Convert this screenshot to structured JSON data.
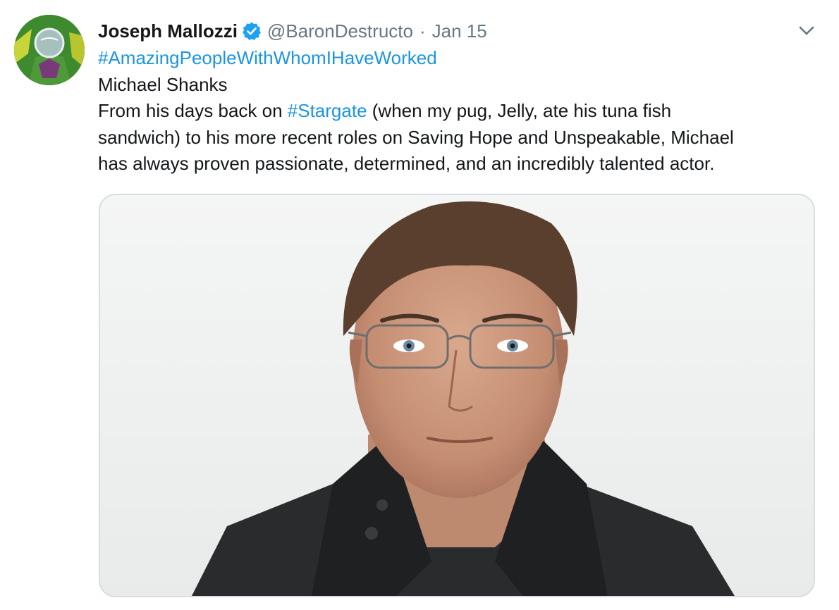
{
  "tweet": {
    "author_name": "Joseph Mallozzi",
    "handle": "@BaronDestructo",
    "separator": "·",
    "date": "Jan 15",
    "hashtag_line": "#AmazingPeopleWithWhomIHaveWorked",
    "line2": "Michael Shanks",
    "line3_prefix": "From his days back on ",
    "line3_hashtag": "#Stargate",
    "line3_suffix": " (when my pug, Jelly, ate his tuna fish",
    "line4": "sandwich) to his more recent roles on Saving Hope and Unspeakable, Michael",
    "line5": "has always proven passionate, determined, and an incredibly talented actor."
  },
  "icons": {
    "verified": "verified-badge-icon",
    "more": "chevron-down-icon"
  },
  "colors": {
    "link": "#1b95e0",
    "secondary_text": "#657786",
    "verified": "#1da1f2",
    "border": "#d7dde2"
  }
}
